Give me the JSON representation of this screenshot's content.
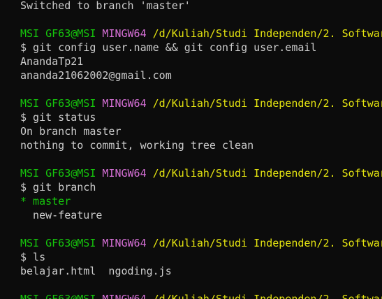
{
  "terminal": {
    "lines": [
      {
        "type": "output",
        "text": "Switched to branch 'master'"
      },
      {
        "type": "blank"
      },
      {
        "type": "prompt",
        "user": "MSI GF63@MSI",
        "system": "MINGW64",
        "path": "/d/Kuliah/Studi Independen/2. Softwar"
      },
      {
        "type": "command",
        "text": "$ git config user.name && git config user.email"
      },
      {
        "type": "output",
        "text": "AnandaTp21"
      },
      {
        "type": "output",
        "text": "ananda21062002@gmail.com"
      },
      {
        "type": "blank"
      },
      {
        "type": "prompt",
        "user": "MSI GF63@MSI",
        "system": "MINGW64",
        "path": "/d/Kuliah/Studi Independen/2. Softwar"
      },
      {
        "type": "command",
        "text": "$ git status"
      },
      {
        "type": "output",
        "text": "On branch master"
      },
      {
        "type": "output",
        "text": "nothing to commit, working tree clean"
      },
      {
        "type": "blank"
      },
      {
        "type": "prompt",
        "user": "MSI GF63@MSI",
        "system": "MINGW64",
        "path": "/d/Kuliah/Studi Independen/2. Softwar"
      },
      {
        "type": "command",
        "text": "$ git branch"
      },
      {
        "type": "current-branch",
        "text": "* master"
      },
      {
        "type": "output",
        "text": "  new-feature"
      },
      {
        "type": "blank"
      },
      {
        "type": "prompt",
        "user": "MSI GF63@MSI",
        "system": "MINGW64",
        "path": "/d/Kuliah/Studi Independen/2. Softwar"
      },
      {
        "type": "command",
        "text": "$ ls"
      },
      {
        "type": "output",
        "text": "belajar.html  ngoding.js"
      },
      {
        "type": "blank"
      },
      {
        "type": "prompt",
        "user": "MSI GF63@MSI",
        "system": "MINGW64",
        "path": "/d/Kuliah/Studi Independen/2. Softwar"
      }
    ]
  },
  "colors": {
    "background": "#0c0c0c",
    "text": "#cccccc",
    "user": "#16c60c",
    "system": "#d670d6",
    "path": "#e5e510",
    "current_branch": "#16c60c"
  }
}
